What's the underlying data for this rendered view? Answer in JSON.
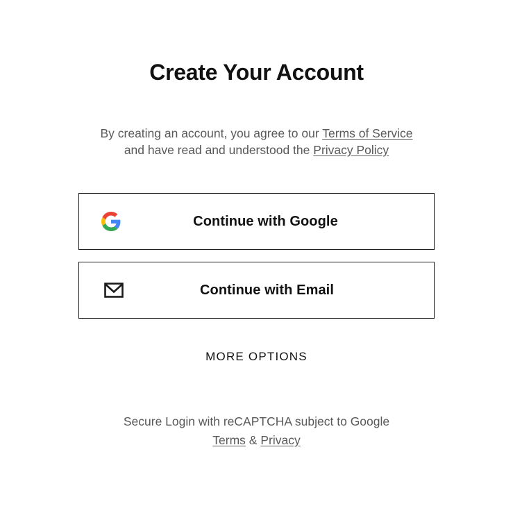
{
  "header": {
    "title": "Create Your Account"
  },
  "agreement": {
    "prefix": "By creating an account, you agree to our ",
    "terms_link": "Terms of Service",
    "middle": "and have read and understood the ",
    "privacy_link": "Privacy Policy"
  },
  "buttons": {
    "google_label": "Continue with Google",
    "google_icon": "google-g-logo",
    "email_label": "Continue with Email",
    "email_icon": "envelope-icon"
  },
  "more_options": {
    "label": "MORE OPTIONS"
  },
  "recaptcha": {
    "text": "Secure Login with reCAPTCHA subject to Google",
    "terms_link": "Terms",
    "separator": " & ",
    "privacy_link": "Privacy"
  },
  "colors": {
    "text": "#111111",
    "muted_text": "#595959",
    "border": "#1a1a1a",
    "google_blue": "#4285F4",
    "google_red": "#EA4335",
    "google_yellow": "#FBBC05",
    "google_green": "#34A853"
  }
}
